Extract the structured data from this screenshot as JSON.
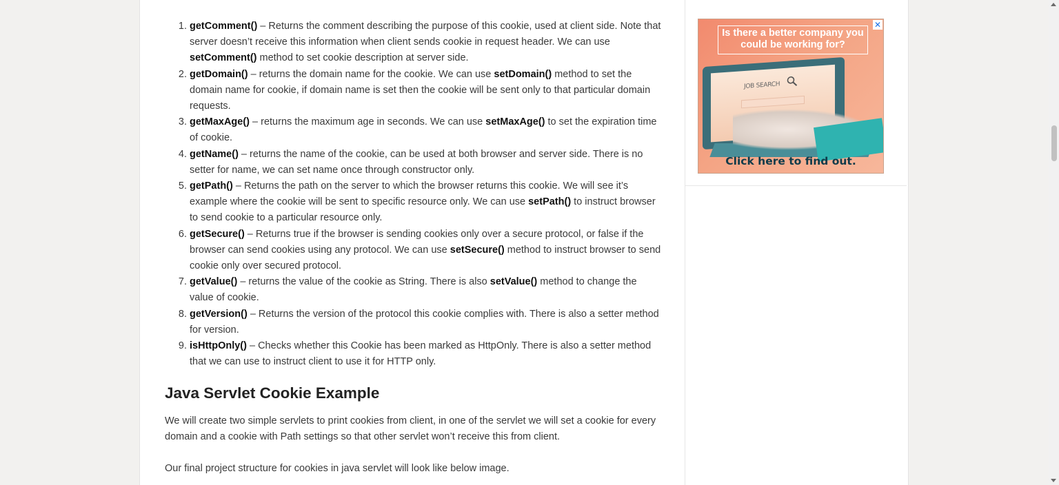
{
  "methods": [
    {
      "num": "1.",
      "name": "getComment()",
      "pre": " – Returns the comment describing the purpose of this cookie, used at client side. Note that server doesn’t receive this information when client sends cookie in request header. We can use ",
      "ref": "setComment()",
      "post": " method to set cookie description at server side."
    },
    {
      "num": "2.",
      "name": "getDomain()",
      "pre": " – returns the domain name for the cookie. We can use ",
      "ref": "setDomain()",
      "post": " method to set the domain name for cookie, if domain name is set then the cookie will be sent only to that particular domain requests."
    },
    {
      "num": "3.",
      "name": "getMaxAge()",
      "pre": " – returns the maximum age in seconds. We can use ",
      "ref": "setMaxAge()",
      "post": " to set the expiration time of cookie."
    },
    {
      "num": "4.",
      "name": "getName()",
      "pre": " – returns the name of the cookie, can be used at both browser and server side. There is no setter for name, we can set name once through constructor only.",
      "ref": "",
      "post": ""
    },
    {
      "num": "5.",
      "name": "getPath()",
      "pre": " – Returns the path on the server to which the browser returns this cookie. We will see it’s example where the cookie will be sent to specific resource only. We can use ",
      "ref": "setPath()",
      "post": " to instruct browser to send cookie to a particular resource only."
    },
    {
      "num": "6.",
      "name": "getSecure()",
      "pre": " – Returns true if the browser is sending cookies only over a secure protocol, or false if the browser can send cookies using any protocol. We can use ",
      "ref": "setSecure()",
      "post": " method to instruct browser to send cookie only over secured protocol."
    },
    {
      "num": "7.",
      "name": "getValue()",
      "pre": " – returns the value of the cookie as String. There is also ",
      "ref": "setValue()",
      "post": " method to change the value of cookie."
    },
    {
      "num": "8.",
      "name": "getVersion()",
      "pre": " – Returns the version of the protocol this cookie complies with. There is also a setter method for version.",
      "ref": "",
      "post": ""
    },
    {
      "num": "9.",
      "name": "isHttpOnly()",
      "pre": " – Checks whether this Cookie has been marked as HttpOnly. There is also a setter method that we can use to instruct client to use it for HTTP only.",
      "ref": "",
      "post": ""
    }
  ],
  "section": {
    "heading": "Java Servlet Cookie Example",
    "para1": "We will create two simple servlets to print cookies from client, in one of the servlet we will set a cookie for every domain and a cookie with Path settings so that other servlet won’t receive this from client.",
    "para2": "Our final project structure for cookies in java servlet will look like below image."
  },
  "ad": {
    "headline": "Is there a better company you could be working for?",
    "search_text": "JOB SEARCH",
    "cta": "Click here to find out.",
    "close": "✕"
  }
}
